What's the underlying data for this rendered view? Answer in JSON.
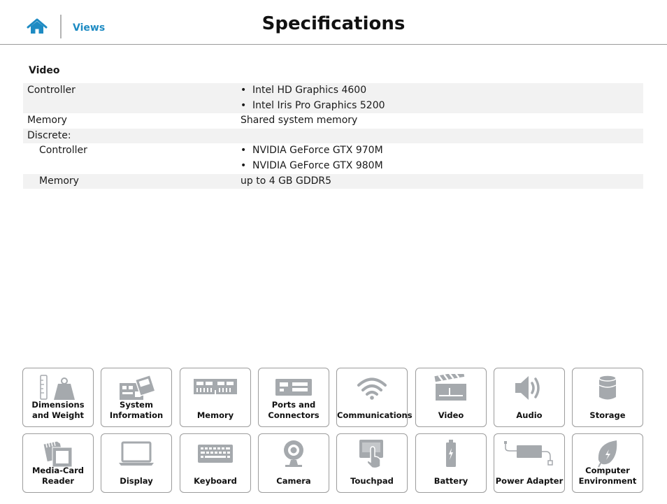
{
  "header": {
    "views_label": "Views",
    "title": "Specifications"
  },
  "section": {
    "title": "Video"
  },
  "rows": {
    "controller": {
      "label": "Controller",
      "items": [
        "Intel HD Graphics 4600",
        "Intel Iris Pro Graphics 5200"
      ]
    },
    "memory": {
      "label": "Memory",
      "value": "Shared system memory"
    },
    "discrete": {
      "label": "Discrete:"
    },
    "discrete_controller": {
      "label": "Controller",
      "items": [
        "NVIDIA GeForce GTX 970M",
        "NVIDIA GeForce GTX 980M"
      ]
    },
    "discrete_memory": {
      "label": "Memory",
      "value": "up to 4 GB GDDR5"
    }
  },
  "bullet_char": "•",
  "tiles": [
    {
      "label": "Dimensions and Weight",
      "icon": "weight-icon"
    },
    {
      "label": "System Information",
      "icon": "motherboard-icon"
    },
    {
      "label": "Memory",
      "icon": "ram-icon"
    },
    {
      "label": "Ports and Connectors",
      "icon": "ports-icon"
    },
    {
      "label": "Communications",
      "icon": "wifi-icon"
    },
    {
      "label": "Video",
      "icon": "clapperboard-icon"
    },
    {
      "label": "Audio",
      "icon": "speaker-icon"
    },
    {
      "label": "Storage",
      "icon": "drive-icon"
    },
    {
      "label": "Media-Card Reader",
      "icon": "media-card-icon"
    },
    {
      "label": "Display",
      "icon": "laptop-icon"
    },
    {
      "label": "Keyboard",
      "icon": "keyboard-icon"
    },
    {
      "label": "Camera",
      "icon": "webcam-icon"
    },
    {
      "label": "Touchpad",
      "icon": "touchpad-icon"
    },
    {
      "label": "Battery",
      "icon": "battery-icon"
    },
    {
      "label": "Power Adapter",
      "icon": "power-adapter-icon"
    },
    {
      "label": "Computer Environment",
      "icon": "leaf-icon"
    }
  ],
  "colors": {
    "accent": "#1e8bc3",
    "icon_gray": "#a5a9ad",
    "row_shade": "#f2f2f2",
    "tile_border": "#9c9c9c"
  }
}
